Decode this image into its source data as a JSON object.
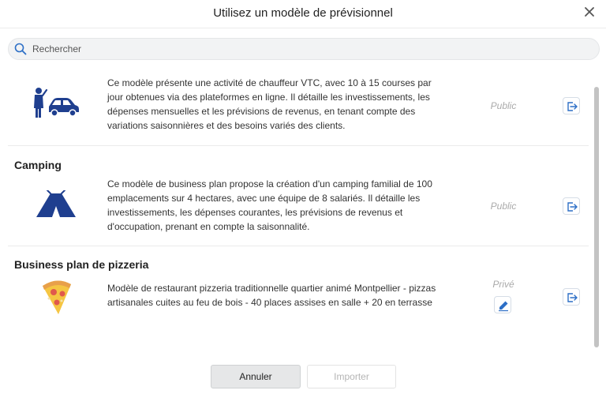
{
  "dialog": {
    "title": "Utilisez un modèle de prévisionnel",
    "close_icon": "close-icon"
  },
  "search": {
    "placeholder": "Rechercher",
    "value": "",
    "icon": "search-icon"
  },
  "templates": [
    {
      "title": "",
      "icon": "vtc-driver-car-icon",
      "description": "Ce modèle présente une activité de chauffeur VTC, avec 10 à 15 courses par jour obtenues via des plateformes en ligne. Il détaille les investissements, les dépenses mensuelles et les prévisions de revenus, en tenant compte des variations saisonnières et des besoins variés des clients.",
      "visibility": "Public",
      "action_icon": "use-template-icon"
    },
    {
      "title": "Camping",
      "icon": "tent-icon",
      "description": "Ce modèle de business plan propose la création d'un camping familial de 100 emplacements sur 4 hectares, avec une équipe de 8 salariés. Il détaille les investissements, les dépenses courantes, les prévisions de revenus et d'occupation, prenant en compte la saisonnalité.",
      "visibility": "Public",
      "action_icon": "use-template-icon"
    },
    {
      "title": "Business plan de pizzeria",
      "icon": "pizza-slice-icon",
      "description": "Modèle de restaurant pizzeria traditionnelle quartier animé Montpellier - pizzas artisanales cuites au feu de bois - 40 places assises en salle + 20 en terrasse",
      "visibility": "Privé",
      "edit_icon": "edit-icon",
      "action_icon": "use-template-icon"
    }
  ],
  "footer": {
    "cancel_label": "Annuler",
    "import_label": "Importer"
  },
  "colors": {
    "accent": "#2d6fc6",
    "icon_blue": "#1f3f8f",
    "muted_text": "#aaaaaa"
  }
}
